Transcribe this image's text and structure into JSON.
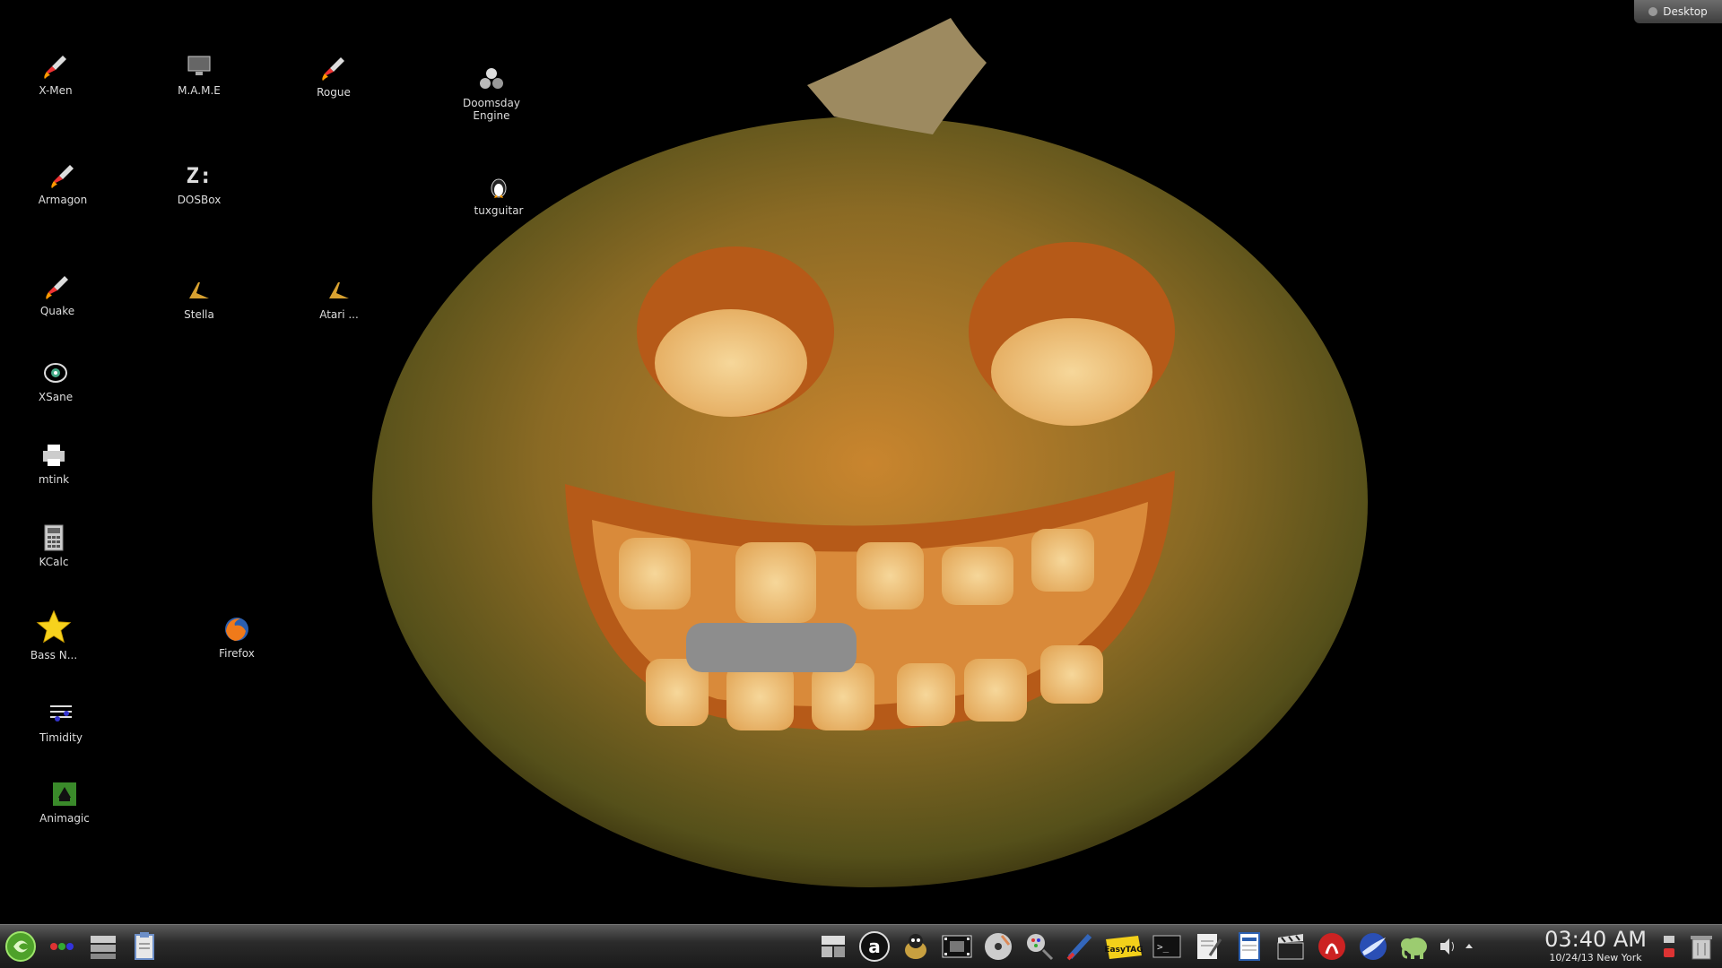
{
  "desktop": {
    "icons": [
      {
        "label": "X-Men",
        "icon": "rocket-icon"
      },
      {
        "label": "M.A.M.E",
        "icon": "computer-icon"
      },
      {
        "label": "Rogue",
        "icon": "rocket-icon"
      },
      {
        "label": "Doomsday\nEngine",
        "icon": "doomsday-icon"
      },
      {
        "label": "Armagon",
        "icon": "rocket-icon"
      },
      {
        "label": "DOSBox",
        "icon": "dosbox-icon"
      },
      {
        "label": "tuxguitar",
        "icon": "penguin-icon"
      },
      {
        "label": "Quake",
        "icon": "rocket-icon"
      },
      {
        "label": "Stella",
        "icon": "joystick-icon"
      },
      {
        "label": "Atari ...",
        "icon": "joystick-icon"
      },
      {
        "label": "XSane",
        "icon": "scanner-icon"
      },
      {
        "label": "mtink",
        "icon": "printer-icon"
      },
      {
        "label": "KCalc",
        "icon": "calculator-icon"
      },
      {
        "label": "Bass N...",
        "icon": "star-icon"
      },
      {
        "label": "Firefox",
        "icon": "firefox-icon"
      },
      {
        "label": "Timidity",
        "icon": "music-icon"
      },
      {
        "label": "Animagic",
        "icon": "animagic-icon"
      }
    ],
    "desktop_button_label": "Desktop"
  },
  "taskbar": {
    "launcher_icons": [
      "app-menu-icon",
      "activities-icon",
      "drawer-icon",
      "clipboard-icon"
    ],
    "tray_icons": [
      "file-manager-icon",
      "amarok-icon",
      "tux-paint-icon",
      "video-editor-icon",
      "disc-burner-icon",
      "graphics-icon",
      "paintbrush-icon",
      "easytag-icon",
      "terminal-icon",
      "text-editor-icon",
      "document-icon",
      "clapper-icon",
      "music-player-icon",
      "browser-icon",
      "elephant-icon",
      "volume-icon",
      "expand-arrow-icon"
    ],
    "easytag_label": "EasyTAG",
    "clock": {
      "time": "03:40 AM",
      "date": "10/24/13 New York"
    }
  },
  "colors": {
    "background": "#000000",
    "taskbar": "#2b2b2b",
    "pumpkin_orange": "#c8782a",
    "pumpkin_green": "#6b6a24"
  }
}
